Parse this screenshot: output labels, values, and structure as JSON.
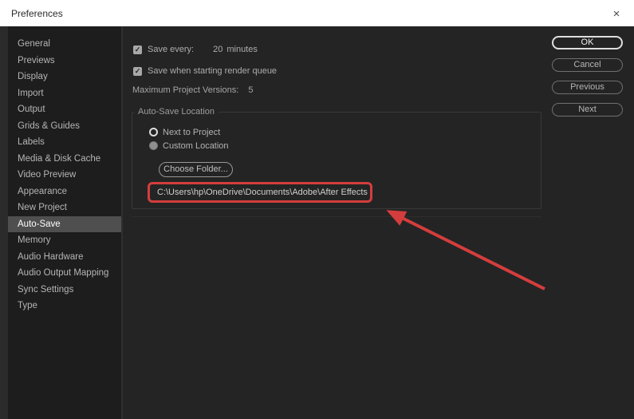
{
  "window": {
    "title": "Preferences"
  },
  "icons": {
    "close": "×",
    "checkbox_check": "✓"
  },
  "colors": {
    "accent_blue": "#4f94d0",
    "annotation_red": "#d43d3d",
    "selected_item_bg": "#4f4f4f"
  },
  "sidebar": {
    "items": [
      {
        "label": "General",
        "selected": false
      },
      {
        "label": "Previews",
        "selected": false
      },
      {
        "label": "Display",
        "selected": false
      },
      {
        "label": "Import",
        "selected": false
      },
      {
        "label": "Output",
        "selected": false
      },
      {
        "label": "Grids & Guides",
        "selected": false
      },
      {
        "label": "Labels",
        "selected": false
      },
      {
        "label": "Media & Disk Cache",
        "selected": false
      },
      {
        "label": "Video Preview",
        "selected": false
      },
      {
        "label": "Appearance",
        "selected": false
      },
      {
        "label": "New Project",
        "selected": false
      },
      {
        "label": "Auto-Save",
        "selected": true
      },
      {
        "label": "Memory",
        "selected": false
      },
      {
        "label": "Audio Hardware",
        "selected": false
      },
      {
        "label": "Audio Output Mapping",
        "selected": false
      },
      {
        "label": "Sync Settings",
        "selected": false
      },
      {
        "label": "Type",
        "selected": false
      }
    ]
  },
  "content": {
    "save_every": {
      "checked": true,
      "label": "Save every:",
      "value": "20",
      "suffix": "minutes"
    },
    "save_render_queue": {
      "checked": true,
      "label": "Save when starting render queue"
    },
    "max_versions": {
      "label": "Maximum Project Versions:",
      "value": "5"
    },
    "autosave_location": {
      "title": "Auto-Save Location",
      "options": [
        {
          "label": "Next to Project",
          "selected": false
        },
        {
          "label": "Custom Location",
          "selected": true
        }
      ],
      "choose_folder_label": "Choose Folder...",
      "path": "C:\\Users\\hp\\OneDrive\\Documents\\Adobe\\After Effects"
    }
  },
  "buttons": [
    "OK",
    "Cancel",
    "Previous",
    "Next"
  ]
}
